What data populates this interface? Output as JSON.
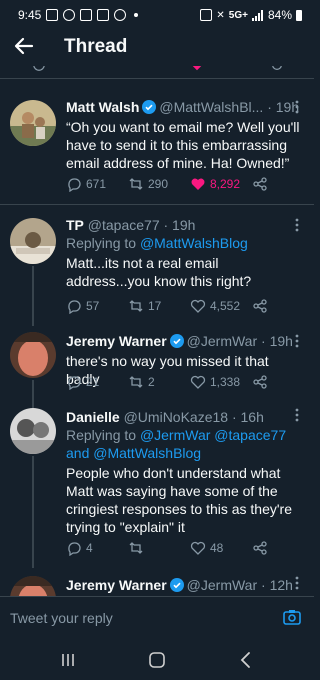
{
  "status": {
    "time": "9:45",
    "network": "5G+",
    "battery": "84%"
  },
  "header": {
    "title": "Thread"
  },
  "tweets": [
    {
      "name": "Matt Walsh",
      "handle": "@MattWalshBl...",
      "time": "· 19h",
      "verified": true,
      "text": "“Oh you want to email me? Well you'll have to send it to this embarrassing email address of mine. Ha! Owned!”",
      "replies": "671",
      "retweets": "290",
      "likes": "8,292",
      "liked": true
    },
    {
      "name": "TP",
      "handle": "@tapace77",
      "time": "· 19h",
      "replying_label": "Replying to",
      "replying_to": "@MattWalshBlog",
      "text": "Matt...its not a real email address...you know this right?",
      "replies": "57",
      "retweets": "17",
      "likes": "4,552"
    },
    {
      "name": "Jeremy Warner",
      "handle": "@JermWar",
      "time": "· 19h",
      "verified": true,
      "text": "there's no way you missed it that badly",
      "replies": "21",
      "retweets": "2",
      "likes": "1,338"
    },
    {
      "name": "Danielle",
      "handle": "@UmiNoKaze18",
      "time": "· 16h",
      "replying_label": "Replying to",
      "replying_to": "@JermWar @tapace77",
      "replying_and": "and",
      "replying_to_2": "@MattWalshBlog",
      "text": "People who don't understand what Matt was saying have some of the cringiest responses to this as they're trying to \"explain\" it",
      "replies": "4",
      "retweets": "",
      "likes": "48"
    },
    {
      "name": "Jeremy Warner",
      "handle": "@JermWar",
      "time": "· 12h",
      "verified": true
    }
  ],
  "reply_bar": {
    "placeholder": "Tweet your reply"
  },
  "colors": {
    "background": "#15202b",
    "accent": "#1d9bf0",
    "like": "#f91880",
    "muted": "#8899a6",
    "divider": "#38444d"
  }
}
